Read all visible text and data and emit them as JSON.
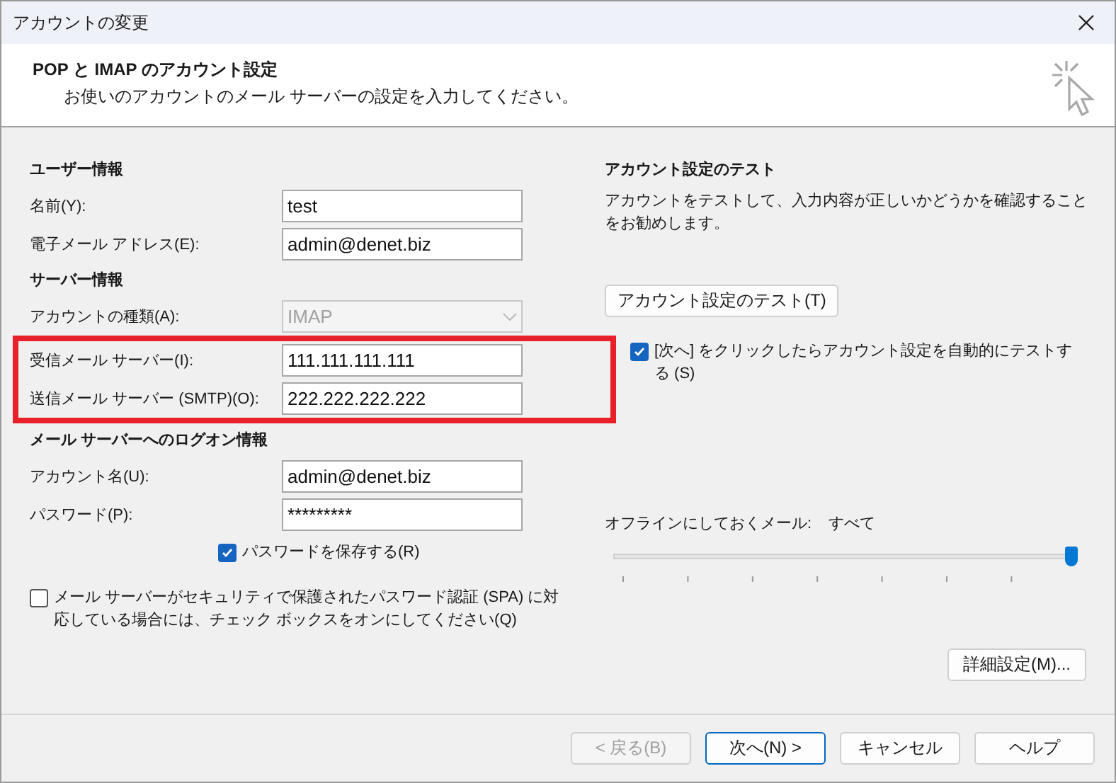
{
  "window": {
    "title": "アカウントの変更"
  },
  "header": {
    "title": "POP と IMAP のアカウント設定",
    "subtitle": "お使いのアカウントのメール サーバーの設定を入力してください。"
  },
  "sections": [
    {
      "heading": "ユーザー情報",
      "rows": [
        {
          "kind": "text",
          "label": "名前(Y):",
          "value": "test",
          "highlighted": false
        },
        {
          "kind": "text",
          "label": "電子メール アドレス(E):",
          "value": "admin@denet.biz",
          "highlighted": false
        }
      ]
    },
    {
      "heading": "サーバー情報",
      "rows": [
        {
          "kind": "select",
          "label": "アカウントの種類(A):",
          "value": "IMAP",
          "disabled": true,
          "highlighted": false
        },
        {
          "kind": "text",
          "label": "受信メール サーバー(I):",
          "value": "111.111.111.111",
          "highlighted": true
        },
        {
          "kind": "text",
          "label": "送信メール サーバー (SMTP)(O):",
          "value": "222.222.222.222",
          "highlighted": true
        }
      ]
    },
    {
      "heading": "メール サーバーへのログオン情報",
      "rows": [
        {
          "kind": "text",
          "label": "アカウント名(U):",
          "value": "admin@denet.biz",
          "highlighted": false
        },
        {
          "kind": "text",
          "label": "パスワード(P):",
          "value": "*********",
          "highlighted": false
        }
      ]
    }
  ],
  "remember_password": {
    "label": "パスワードを保存する(R)",
    "checked": true
  },
  "spa": {
    "label": "メール サーバーがセキュリティで保護されたパスワード認証 (SPA) に対応している場合には、チェック ボックスをオンにしてください(Q)",
    "checked": false
  },
  "test": {
    "heading": "アカウント設定のテスト",
    "description": "アカウントをテストして、入力内容が正しいかどうかを確認することをお勧めします。",
    "button": "アカウント設定のテスト(T)",
    "auto_test": {
      "label": "[次へ] をクリックしたらアカウント設定を自動的にテストする (S)",
      "checked": true
    }
  },
  "offline": {
    "label": "オフラインにしておくメール:",
    "value": "すべて",
    "level": 1
  },
  "advanced_button": "詳細設定(M)...",
  "buttons": [
    {
      "label": "< 戻る(B)",
      "disabled": true,
      "default": false
    },
    {
      "label": "次へ(N) >",
      "disabled": false,
      "default": true
    },
    {
      "label": "キャンセル",
      "disabled": false,
      "default": false
    },
    {
      "label": "ヘルプ",
      "disabled": false,
      "default": false
    }
  ]
}
